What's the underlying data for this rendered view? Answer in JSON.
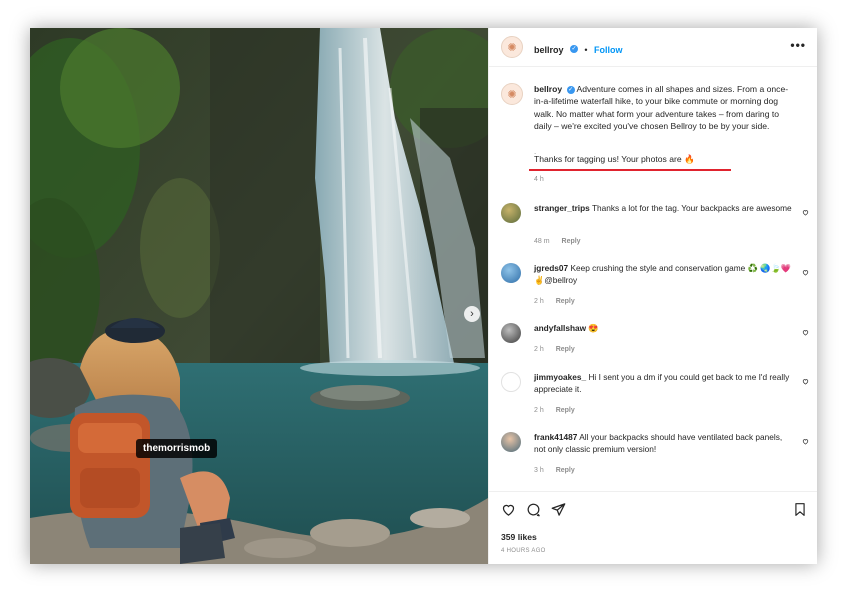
{
  "post": {
    "photo_tag": "themorrismob",
    "header": {
      "username": "bellroy",
      "follow_label": "Follow",
      "more_label": "•••"
    },
    "caption": {
      "username": "bellroy",
      "text": "Adventure comes in all shapes and sizes. From a once-in-a-lifetime waterfall hike, to your bike commute or morning dog walk. No matter what form your adventure takes – from daring to daily – we're excited you've chosen Bellroy to be by your side.",
      "separator": ".",
      "reply_text": "Thanks for tagging us! Your photos are 🔥",
      "time": "4 h"
    },
    "comments": [
      {
        "username": "stranger_trips",
        "text": "Thanks a lot for the tag. Your backpacks are awesome",
        "time": "48 m",
        "reply": "Reply"
      },
      {
        "username": "jgreds07",
        "text": "Keep crushing the style and conservation game ♻️ 🌏🍃💗✌@bellroy",
        "time": "2 h",
        "reply": "Reply"
      },
      {
        "username": "andyfallshaw",
        "text": "😍",
        "time": "2 h",
        "reply": "Reply"
      },
      {
        "username": "jimmyoakes_",
        "text": "Hi I sent you a dm if you could get back to me I'd really appreciate it.",
        "time": "2 h",
        "reply": "Reply"
      },
      {
        "username": "frank41487",
        "text": "All your backpacks should have ventilated back panels, not only classic premium version!",
        "time": "3 h",
        "reply": "Reply"
      }
    ],
    "likes": "359 likes",
    "posted_ago": "4 HOURS AGO"
  },
  "colors": {
    "link_blue": "#0095f6",
    "highlight_red": "#e0232e",
    "muted_gray": "#8e8e8e"
  },
  "icons": [
    "heart-icon",
    "comment-icon",
    "share-icon",
    "bookmark-icon",
    "verified-badge-icon",
    "next-arrow-icon",
    "more-options-icon"
  ]
}
